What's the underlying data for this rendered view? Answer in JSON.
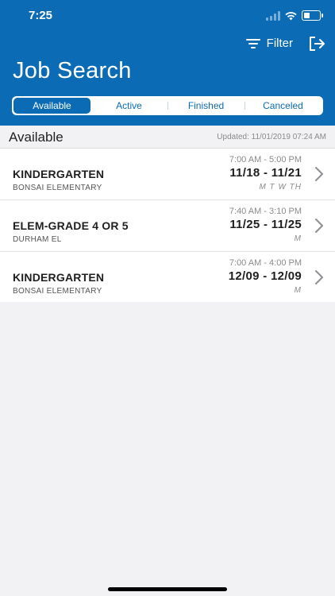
{
  "status_bar": {
    "time": "7:25"
  },
  "header": {
    "filter_label": "Filter",
    "title": "Job Search",
    "tabs": [
      {
        "label": "Available",
        "active": true
      },
      {
        "label": "Active",
        "active": false
      },
      {
        "label": "Finished",
        "active": false
      },
      {
        "label": "Canceled",
        "active": false
      }
    ]
  },
  "section": {
    "title": "Available",
    "updated": "Updated: 11/01/2019 07:24 AM"
  },
  "jobs": [
    {
      "title": "KINDERGARTEN",
      "school": "BONSAI ELEMENTARY",
      "time_range": "7:00 AM - 5:00 PM",
      "date_range": "11/18 - 11/21",
      "days": "M T W TH"
    },
    {
      "title": "ELEM-GRADE 4 OR 5",
      "school": "DURHAM EL",
      "time_range": "7:40 AM - 3:10 PM",
      "date_range": "11/25 - 11/25",
      "days": "M"
    },
    {
      "title": "KINDERGARTEN",
      "school": "BONSAI ELEMENTARY",
      "time_range": "7:00 AM - 4:00 PM",
      "date_range": "12/09 - 12/09",
      "days": "M"
    }
  ],
  "colors": {
    "brand": "#0b6cb5",
    "background": "#f2f2f4"
  },
  "icons": [
    "signal-icon",
    "wifi-icon",
    "battery-icon",
    "filter-icon",
    "logout-icon",
    "chevron-right-icon"
  ]
}
